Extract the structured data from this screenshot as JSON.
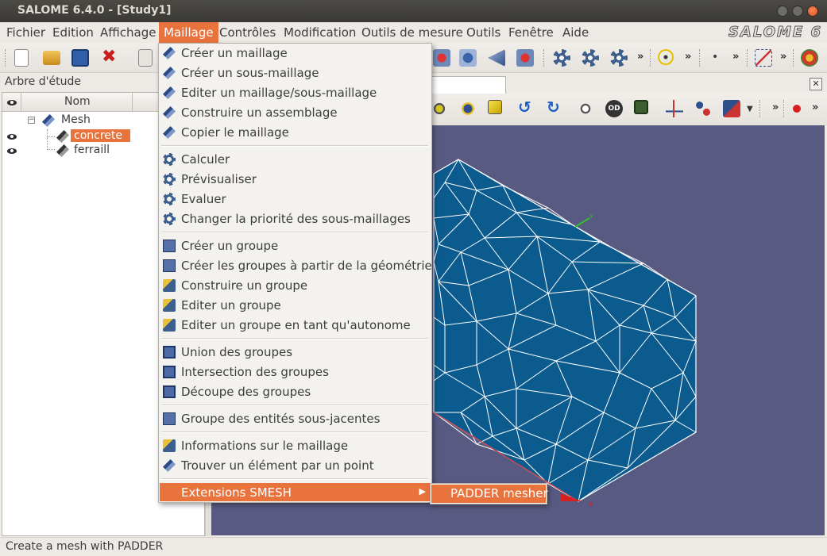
{
  "window": {
    "title": "SALOME 6.4.0 - [Study1]"
  },
  "menubar": {
    "items": [
      "Fichier",
      "Edition",
      "Affichage",
      "Maillage",
      "Contrôles",
      "Modification",
      "Outils de mesure",
      "Outils",
      "Fenêtre",
      "Aide"
    ],
    "active": "Maillage",
    "logo": "SALOME 6"
  },
  "left_panel": {
    "title": "Arbre d'étude",
    "column": "Nom",
    "tree": [
      {
        "label": "Mesh",
        "level": 0
      },
      {
        "label": "concrete",
        "level": 1,
        "selected": true,
        "visible": true
      },
      {
        "label": "ferraill",
        "level": 1,
        "selected": false,
        "visible": true
      }
    ]
  },
  "menu": {
    "items": [
      {
        "label": "Créer un maillage",
        "icon": "create-mesh-icon"
      },
      {
        "label": "Créer un sous-maillage",
        "icon": "create-submesh-icon"
      },
      {
        "label": "Editer un maillage/sous-maillage",
        "icon": "edit-mesh-icon"
      },
      {
        "label": "Construire un assemblage",
        "icon": "build-compound-icon"
      },
      {
        "label": "Copier le maillage",
        "icon": "copy-mesh-icon"
      },
      {
        "label": "Calculer",
        "icon": "compute-icon"
      },
      {
        "label": "Prévisualiser",
        "icon": "preview-icon"
      },
      {
        "label": "Evaluer",
        "icon": "evaluate-icon"
      },
      {
        "label": "Changer la priorité des sous-maillages",
        "icon": "submesh-priority-icon"
      },
      {
        "label": "Créer un groupe",
        "icon": "create-group-icon"
      },
      {
        "label": "Créer les groupes à partir de la géométrie",
        "icon": "groups-from-geometry-icon"
      },
      {
        "label": "Construire un groupe",
        "icon": "construct-group-icon"
      },
      {
        "label": "Editer un groupe",
        "icon": "edit-group-icon"
      },
      {
        "label": "Editer un groupe en tant qu'autonome",
        "icon": "edit-group-standalone-icon"
      },
      {
        "label": "Union des groupes",
        "icon": "union-groups-icon"
      },
      {
        "label": "Intersection des groupes",
        "icon": "intersect-groups-icon"
      },
      {
        "label": "Découpe des groupes",
        "icon": "cut-groups-icon"
      },
      {
        "label": "Groupe des entités sous-jacentes",
        "icon": "underlying-entities-group-icon"
      },
      {
        "label": "Informations sur le maillage",
        "icon": "mesh-info-icon"
      },
      {
        "label": "Trouver un élément par un point",
        "icon": "find-element-icon"
      },
      {
        "label": "Extensions SMESH",
        "icon": "",
        "submenu": true
      }
    ],
    "submenu_items": [
      "PADDER mesher"
    ]
  },
  "status_bar": {
    "text": "Create a mesh with PADDER"
  },
  "colors": {
    "accent": "#e8733c",
    "viewer_bg": "#595a82",
    "mesh_fill": "#0b5b8f",
    "mesh_edge": "#ffffff"
  }
}
